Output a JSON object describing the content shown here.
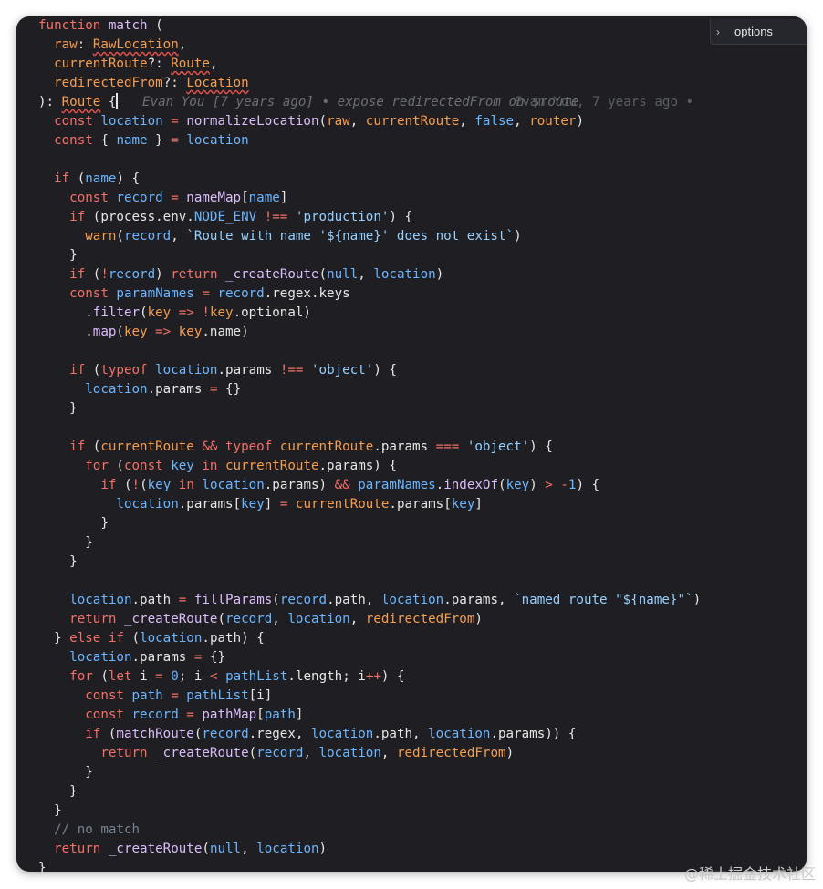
{
  "options": {
    "label": "options",
    "chevron": "›"
  },
  "blame": {
    "inline": "Evan You [7 years ago] • expose redirectedFrom on $route",
    "right": "Evan You, 7 years ago •"
  },
  "watermark": "@稀土掘金技术社区",
  "code_lines": [
    [
      [
        "k",
        "function "
      ],
      [
        "f",
        "match"
      ],
      [
        "w",
        " ("
      ]
    ],
    [
      [
        "w",
        "  "
      ],
      [
        "p",
        "raw"
      ],
      [
        "w",
        ": "
      ],
      [
        "t sq",
        "RawLocation"
      ],
      [
        "w",
        ","
      ]
    ],
    [
      [
        "w",
        "  "
      ],
      [
        "p",
        "currentRoute"
      ],
      [
        "w",
        "?: "
      ],
      [
        "t sq",
        "Route"
      ],
      [
        "w",
        ","
      ]
    ],
    [
      [
        "w",
        "  "
      ],
      [
        "p",
        "redirectedFrom"
      ],
      [
        "w",
        "?: "
      ],
      [
        "t sq",
        "Location"
      ]
    ],
    [
      [
        "w",
        "): "
      ],
      [
        "t sq",
        "Route"
      ],
      [
        "w",
        " {"
      ],
      [
        "cursor",
        ""
      ],
      [
        "blame",
        "   Evan You [7 years ago] • expose redirectedFrom on $route"
      ],
      [
        "blameright",
        "Evan You, 7 years ago •"
      ]
    ],
    [
      [
        "w",
        "  "
      ],
      [
        "k",
        "const "
      ],
      [
        "v",
        "location"
      ],
      [
        "k",
        " = "
      ],
      [
        "f",
        "normalizeLocation"
      ],
      [
        "w",
        "("
      ],
      [
        "p",
        "raw"
      ],
      [
        "w",
        ", "
      ],
      [
        "p",
        "currentRoute"
      ],
      [
        "w",
        ", "
      ],
      [
        "v",
        "false"
      ],
      [
        "w",
        ", "
      ],
      [
        "p",
        "router"
      ],
      [
        "w",
        ")"
      ]
    ],
    [
      [
        "w",
        "  "
      ],
      [
        "k",
        "const "
      ],
      [
        "w",
        "{ "
      ],
      [
        "v",
        "name"
      ],
      [
        "w",
        " } "
      ],
      [
        "k",
        "= "
      ],
      [
        "v",
        "location"
      ]
    ],
    [
      [
        "w",
        ""
      ]
    ],
    [
      [
        "w",
        "  "
      ],
      [
        "k",
        "if "
      ],
      [
        "w",
        "("
      ],
      [
        "v",
        "name"
      ],
      [
        "w",
        ") {"
      ]
    ],
    [
      [
        "w",
        "    "
      ],
      [
        "k",
        "const "
      ],
      [
        "v",
        "record"
      ],
      [
        "k",
        " = "
      ],
      [
        "f",
        "nameMap"
      ],
      [
        "w",
        "["
      ],
      [
        "v",
        "name"
      ],
      [
        "w",
        "]"
      ]
    ],
    [
      [
        "w",
        "    "
      ],
      [
        "k",
        "if "
      ],
      [
        "w",
        "(process.env."
      ],
      [
        "v",
        "NODE_ENV"
      ],
      [
        "k",
        " !== "
      ],
      [
        "s",
        "'production'"
      ],
      [
        "w",
        ") {"
      ]
    ],
    [
      [
        "w",
        "      "
      ],
      [
        "p",
        "warn"
      ],
      [
        "w",
        "("
      ],
      [
        "v",
        "record"
      ],
      [
        "w",
        ", "
      ],
      [
        "s",
        "`Route with name '${name}' does not exist`"
      ],
      [
        "w",
        ")"
      ]
    ],
    [
      [
        "w",
        "    }"
      ]
    ],
    [
      [
        "w",
        "    "
      ],
      [
        "k",
        "if "
      ],
      [
        "w",
        "("
      ],
      [
        "k",
        "!"
      ],
      [
        "v",
        "record"
      ],
      [
        "w",
        ") "
      ],
      [
        "k",
        "return "
      ],
      [
        "f",
        "_createRoute"
      ],
      [
        "w",
        "("
      ],
      [
        "v",
        "null"
      ],
      [
        "w",
        ", "
      ],
      [
        "v",
        "location"
      ],
      [
        "w",
        ")"
      ]
    ],
    [
      [
        "w",
        "    "
      ],
      [
        "k",
        "const "
      ],
      [
        "v",
        "paramNames"
      ],
      [
        "k",
        " = "
      ],
      [
        "v",
        "record"
      ],
      [
        "w",
        ".regex.keys"
      ]
    ],
    [
      [
        "w",
        "      ."
      ],
      [
        "f",
        "filter"
      ],
      [
        "w",
        "("
      ],
      [
        "p",
        "key"
      ],
      [
        "k",
        " => "
      ],
      [
        "k",
        "!"
      ],
      [
        "p",
        "key"
      ],
      [
        "w",
        ".optional)"
      ]
    ],
    [
      [
        "w",
        "      ."
      ],
      [
        "f",
        "map"
      ],
      [
        "w",
        "("
      ],
      [
        "p",
        "key"
      ],
      [
        "k",
        " => "
      ],
      [
        "p",
        "key"
      ],
      [
        "w",
        ".name)"
      ]
    ],
    [
      [
        "w",
        ""
      ]
    ],
    [
      [
        "w",
        "    "
      ],
      [
        "k",
        "if "
      ],
      [
        "w",
        "("
      ],
      [
        "k",
        "typeof "
      ],
      [
        "v",
        "location"
      ],
      [
        "w",
        ".params "
      ],
      [
        "k",
        "!== "
      ],
      [
        "s",
        "'object'"
      ],
      [
        "w",
        ") {"
      ]
    ],
    [
      [
        "w",
        "      "
      ],
      [
        "v",
        "location"
      ],
      [
        "w",
        ".params "
      ],
      [
        "k",
        "= "
      ],
      [
        "w",
        "{}"
      ]
    ],
    [
      [
        "w",
        "    }"
      ]
    ],
    [
      [
        "w",
        ""
      ]
    ],
    [
      [
        "w",
        "    "
      ],
      [
        "k",
        "if "
      ],
      [
        "w",
        "("
      ],
      [
        "p",
        "currentRoute"
      ],
      [
        "k",
        " && typeof "
      ],
      [
        "p",
        "currentRoute"
      ],
      [
        "w",
        ".params "
      ],
      [
        "k",
        "=== "
      ],
      [
        "s",
        "'object'"
      ],
      [
        "w",
        ") {"
      ]
    ],
    [
      [
        "w",
        "      "
      ],
      [
        "k",
        "for "
      ],
      [
        "w",
        "("
      ],
      [
        "k",
        "const "
      ],
      [
        "v",
        "key"
      ],
      [
        "k",
        " in "
      ],
      [
        "p",
        "currentRoute"
      ],
      [
        "w",
        ".params) {"
      ]
    ],
    [
      [
        "w",
        "        "
      ],
      [
        "k",
        "if "
      ],
      [
        "w",
        "("
      ],
      [
        "k",
        "!"
      ],
      [
        "w",
        "("
      ],
      [
        "v",
        "key"
      ],
      [
        "k",
        " in "
      ],
      [
        "v",
        "location"
      ],
      [
        "w",
        ".params) "
      ],
      [
        "k",
        "&& "
      ],
      [
        "v",
        "paramNames"
      ],
      [
        "w",
        "."
      ],
      [
        "f",
        "indexOf"
      ],
      [
        "w",
        "("
      ],
      [
        "v",
        "key"
      ],
      [
        "w",
        ") "
      ],
      [
        "k",
        "> -"
      ],
      [
        "v",
        "1"
      ],
      [
        "w",
        ") {"
      ]
    ],
    [
      [
        "w",
        "          "
      ],
      [
        "v",
        "location"
      ],
      [
        "w",
        ".params["
      ],
      [
        "v",
        "key"
      ],
      [
        "w",
        "] "
      ],
      [
        "k",
        "= "
      ],
      [
        "p",
        "currentRoute"
      ],
      [
        "w",
        ".params["
      ],
      [
        "v",
        "key"
      ],
      [
        "w",
        "]"
      ]
    ],
    [
      [
        "w",
        "        }"
      ]
    ],
    [
      [
        "w",
        "      }"
      ]
    ],
    [
      [
        "w",
        "    }"
      ]
    ],
    [
      [
        "w",
        ""
      ]
    ],
    [
      [
        "w",
        "    "
      ],
      [
        "v",
        "location"
      ],
      [
        "w",
        ".path "
      ],
      [
        "k",
        "= "
      ],
      [
        "f",
        "fillParams"
      ],
      [
        "w",
        "("
      ],
      [
        "v",
        "record"
      ],
      [
        "w",
        ".path, "
      ],
      [
        "v",
        "location"
      ],
      [
        "w",
        ".params, "
      ],
      [
        "s",
        "`named route \"${name}\"`"
      ],
      [
        "w",
        ")"
      ]
    ],
    [
      [
        "w",
        "    "
      ],
      [
        "k",
        "return "
      ],
      [
        "f",
        "_createRoute"
      ],
      [
        "w",
        "("
      ],
      [
        "v",
        "record"
      ],
      [
        "w",
        ", "
      ],
      [
        "v",
        "location"
      ],
      [
        "w",
        ", "
      ],
      [
        "p",
        "redirectedFrom"
      ],
      [
        "w",
        ")"
      ]
    ],
    [
      [
        "w",
        "  } "
      ],
      [
        "k",
        "else if "
      ],
      [
        "w",
        "("
      ],
      [
        "v",
        "location"
      ],
      [
        "w",
        ".path) {"
      ]
    ],
    [
      [
        "w",
        "    "
      ],
      [
        "v",
        "location"
      ],
      [
        "w",
        ".params "
      ],
      [
        "k",
        "= "
      ],
      [
        "w",
        "{}"
      ]
    ],
    [
      [
        "w",
        "    "
      ],
      [
        "k",
        "for "
      ],
      [
        "w",
        "("
      ],
      [
        "k",
        "let "
      ],
      [
        "w",
        "i "
      ],
      [
        "k",
        "= "
      ],
      [
        "v",
        "0"
      ],
      [
        "w",
        "; i "
      ],
      [
        "k",
        "< "
      ],
      [
        "v",
        "pathList"
      ],
      [
        "w",
        ".length; i"
      ],
      [
        "k",
        "++"
      ],
      [
        "w",
        ") {"
      ]
    ],
    [
      [
        "w",
        "      "
      ],
      [
        "k",
        "const "
      ],
      [
        "v",
        "path"
      ],
      [
        "k",
        " = "
      ],
      [
        "v",
        "pathList"
      ],
      [
        "w",
        "[i]"
      ]
    ],
    [
      [
        "w",
        "      "
      ],
      [
        "k",
        "const "
      ],
      [
        "v",
        "record"
      ],
      [
        "k",
        " = "
      ],
      [
        "f",
        "pathMap"
      ],
      [
        "w",
        "["
      ],
      [
        "v",
        "path"
      ],
      [
        "w",
        "]"
      ]
    ],
    [
      [
        "w",
        "      "
      ],
      [
        "k",
        "if "
      ],
      [
        "w",
        "("
      ],
      [
        "f",
        "matchRoute"
      ],
      [
        "w",
        "("
      ],
      [
        "v",
        "record"
      ],
      [
        "w",
        ".regex, "
      ],
      [
        "v",
        "location"
      ],
      [
        "w",
        ".path, "
      ],
      [
        "v",
        "location"
      ],
      [
        "w",
        ".params)) {"
      ]
    ],
    [
      [
        "w",
        "        "
      ],
      [
        "k",
        "return "
      ],
      [
        "f",
        "_createRoute"
      ],
      [
        "w",
        "("
      ],
      [
        "v",
        "record"
      ],
      [
        "w",
        ", "
      ],
      [
        "v",
        "location"
      ],
      [
        "w",
        ", "
      ],
      [
        "p",
        "redirectedFrom"
      ],
      [
        "w",
        ")"
      ]
    ],
    [
      [
        "w",
        "      }"
      ]
    ],
    [
      [
        "w",
        "    }"
      ]
    ],
    [
      [
        "w",
        "  }"
      ]
    ],
    [
      [
        "w",
        "  "
      ],
      [
        "c",
        "// no match"
      ]
    ],
    [
      [
        "w",
        "  "
      ],
      [
        "k",
        "return "
      ],
      [
        "f",
        "_createRoute"
      ],
      [
        "w",
        "("
      ],
      [
        "v",
        "null"
      ],
      [
        "w",
        ", "
      ],
      [
        "v",
        "location"
      ],
      [
        "w",
        ")"
      ]
    ],
    [
      [
        "w",
        "}"
      ]
    ]
  ]
}
